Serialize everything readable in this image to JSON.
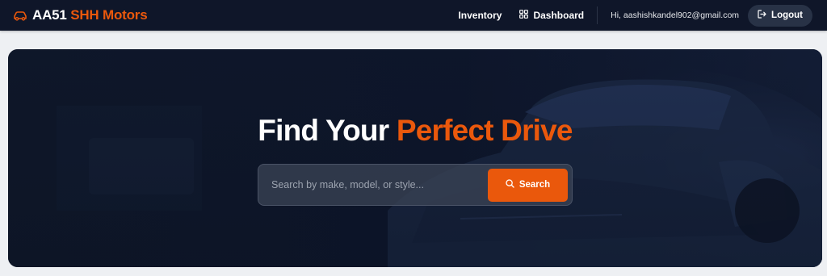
{
  "navbar": {
    "brand_primary": "AA51",
    "brand_accent": "SHH Motors",
    "links": {
      "inventory": "Inventory",
      "dashboard": "Dashboard"
    },
    "greeting": "Hi, aashishkandel902@gmail.com",
    "logout_label": "Logout"
  },
  "hero": {
    "title_primary": "Find Your",
    "title_accent": "Perfect Drive",
    "search_placeholder": "Search by make, model, or style...",
    "search_button": "Search"
  },
  "icons": {
    "brand": "car-icon",
    "dashboard": "grid-icon",
    "logout": "logout-icon",
    "search": "search-icon"
  },
  "colors": {
    "accent": "#ea580c",
    "navbar_bg": "#0f1629",
    "hero_bg": "#0d1424",
    "logout_bg": "#283246"
  }
}
